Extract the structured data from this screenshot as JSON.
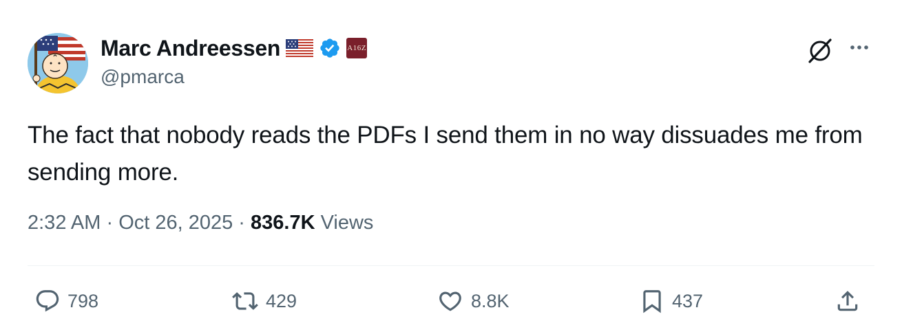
{
  "author": {
    "display_name": "Marc Andreessen",
    "handle": "@pmarca",
    "badges": [
      "us-flag-icon",
      "verified-icon",
      "a16z-affiliate-badge"
    ],
    "affiliate_label": "A16Z"
  },
  "header_actions": {
    "grok_icon": "grok-icon",
    "more_icon": "more-icon"
  },
  "tweet": {
    "text": "The fact that nobody reads the PDFs I send them in no way dissuades me from sending more."
  },
  "meta": {
    "time": "2:32 AM",
    "separator1": " · ",
    "date": "Oct 26, 2025",
    "separator2": " · ",
    "views_count": "836.7K",
    "views_label": " Views"
  },
  "actions": {
    "replies": "798",
    "reposts": "429",
    "likes": "8.8K",
    "bookmarks": "437"
  },
  "colors": {
    "text_primary": "#0f1419",
    "text_secondary": "#536471",
    "verified_blue": "#1d9bf0",
    "divider": "#eff3f4"
  }
}
